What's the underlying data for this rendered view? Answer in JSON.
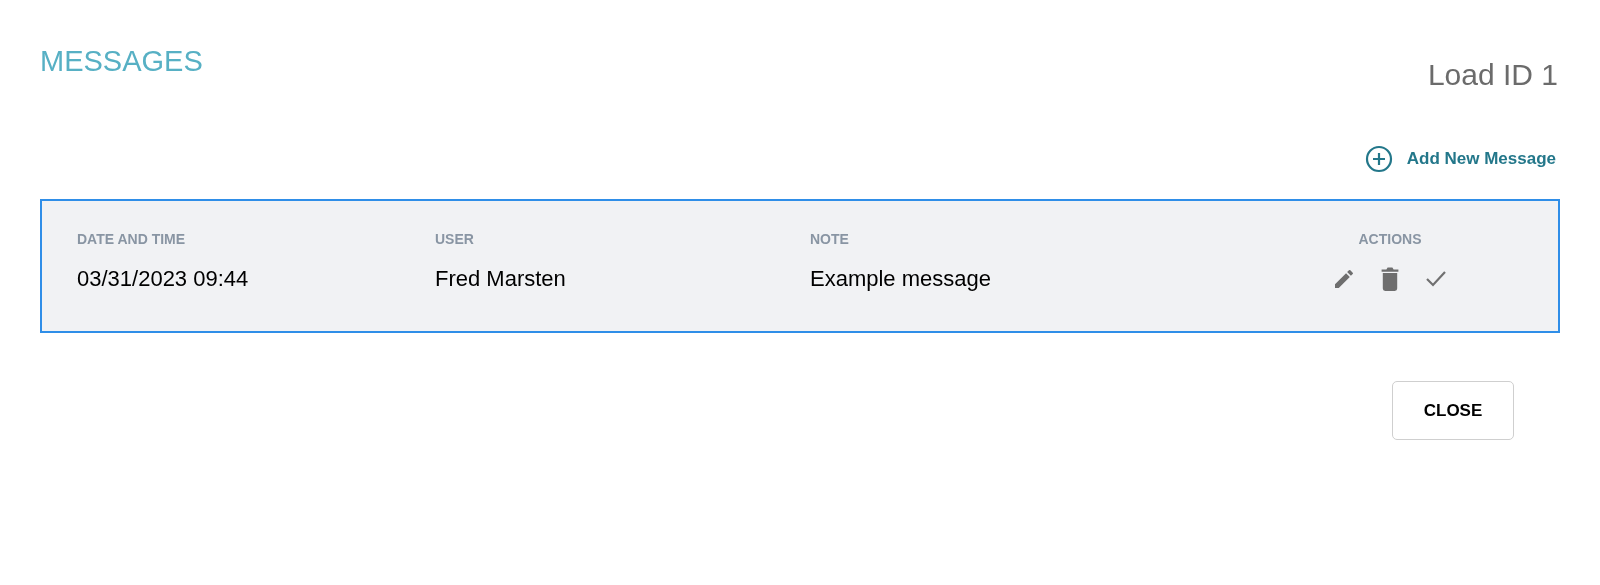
{
  "title": "MESSAGES",
  "load_id": "Load ID 1",
  "add_button": {
    "label": "Add New Message"
  },
  "table": {
    "columns": [
      "DATE AND TIME",
      "USER",
      "NOTE",
      "ACTIONS"
    ],
    "rows": [
      {
        "date_time": "03/31/2023 09:44",
        "user": "Fred Marsten",
        "note": "Example message",
        "actions": [
          {
            "kind": "edit"
          },
          {
            "kind": "delete"
          },
          {
            "kind": "check"
          }
        ]
      }
    ]
  },
  "close_button": {
    "label": "CLOSE"
  }
}
